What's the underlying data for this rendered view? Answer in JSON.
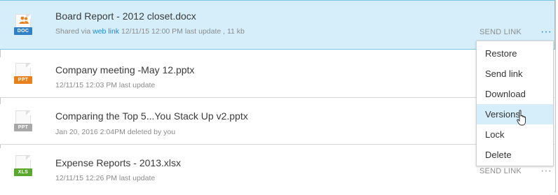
{
  "colors": {
    "accent": "#1e8ad6",
    "selected_bg": "#d5eefa",
    "doc": "#2f80c8",
    "ppt": "#e8801c",
    "ppt_gray": "#a8a8a8",
    "xls": "#59a82e",
    "people": "#e8801c"
  },
  "files": [
    {
      "icon": "doc-shared-icon",
      "badge": "DOC",
      "name": "Board Report - 2012 closet.docx",
      "meta_prefix": "Shared via ",
      "meta_link": "web link",
      "meta_suffix": " 12/11/15 12:00 PM last update , 11 kb",
      "send_link": "SEND LINK",
      "more": "···"
    },
    {
      "icon": "ppt-icon",
      "badge": "PPT",
      "name": "Company meeting -May 12.pptx",
      "meta": "12/11/15 12:03 PM last update"
    },
    {
      "icon": "ppt-deleted-icon",
      "badge": "PPT",
      "name": "Comparing the Top 5...You Stack Up v2.pptx",
      "meta": "Jan 20, 2016 2:04PM deleted by you"
    },
    {
      "icon": "xls-icon",
      "badge": "XLS",
      "name": "Expense Reports - 2013.xlsx",
      "meta": "12/11/15 12:26 PM last update",
      "send_link": "SEND LINK",
      "more": "···"
    }
  ],
  "menu": {
    "items": [
      "Restore",
      "Send link",
      "Download",
      "Versions",
      "Lock",
      "Delete"
    ],
    "hovered": "Versions"
  }
}
